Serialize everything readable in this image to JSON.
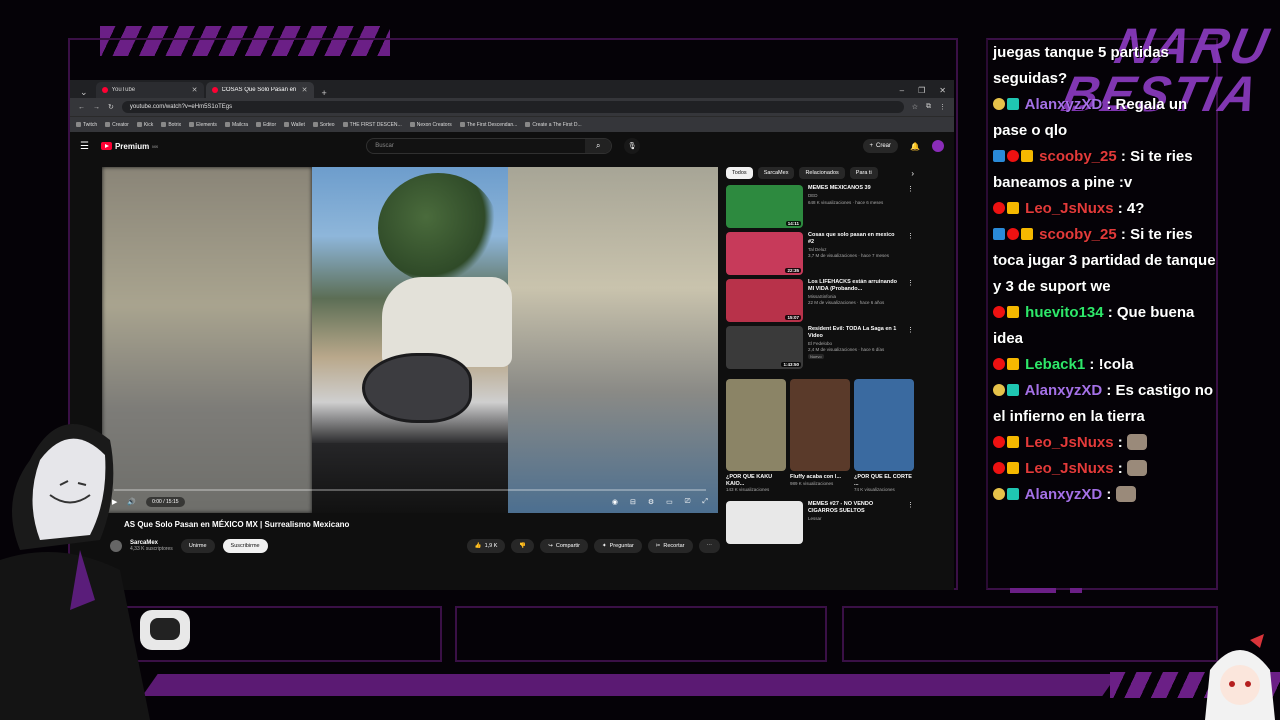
{
  "browser": {
    "tabs": [
      {
        "label": "YouTube"
      },
      {
        "label": "COSAS Que Solo Pasan en MÉX..."
      }
    ],
    "url": "youtube.com/watch?v=eHm5S1oTEgs",
    "bookmarks": [
      "Twitch",
      "Creator",
      "Kick",
      "Botrix",
      "Elements",
      "Mailcra",
      "Editor",
      "Wallet",
      "Sorteo",
      "THE FIRST DESCEN...",
      "Nexon Creators",
      "The First Descendan...",
      "Create a The First D..."
    ]
  },
  "youtube": {
    "logo": "Premium",
    "logo_region": "MX",
    "search_placeholder": "Buscar",
    "create_label": "Crear",
    "player": {
      "time": "0:00 / 15:15"
    },
    "video_title": "AS Que Solo Pasan en MÉXICO MX | Surrealismo Mexicano",
    "channel": {
      "name": "SarcaMex",
      "subs": "4,33 K suscriptores",
      "join_label": "Unirme",
      "subscribe_label": "Suscribirme"
    },
    "actions": {
      "likes": "1,9 K",
      "share": "Compartir",
      "ask": "Preguntar",
      "clip": "Recortar"
    },
    "chips": [
      "Todos",
      "SarcaMex",
      "Relacionados",
      "Para ti"
    ],
    "recommendations": [
      {
        "title": "MEMES MEXICANOS 39",
        "channel": "DED",
        "meta": "648 K visualizaciones · hace 6 meses",
        "duration": "14:11",
        "color": "#2d8a3f"
      },
      {
        "title": "Cosas que solo pasan en mexico #2",
        "channel": "Tal Deluz",
        "meta": "3,7 M de visualizaciones · hace 7 meses",
        "duration": "22:35",
        "color": "#c73a5a"
      },
      {
        "title": "Los LIFEHACKS están arruinando MI VIDA (Probando...",
        "channel": "MissaSinfonia",
        "meta": "22 M de visualizaciones · hace 6 años",
        "duration": "15:07",
        "color": "#b8324a"
      },
      {
        "title": "Resident Evil: TODA La Saga en 1 Video",
        "channel": "El Fedelobo",
        "meta": "2,4 M de visualizaciones · hace 6 días",
        "duration": "1:43:50",
        "badge": "Nuevo",
        "color": "#3a3a3a"
      }
    ],
    "shorts": [
      {
        "title": "¿POR QUE KAKU KAIO...",
        "views": "143 K visualizaciones",
        "color": "#8b8466"
      },
      {
        "title": "Fluffy acaba con l...",
        "views": "989 K visualizaciones",
        "color": "#5a3a2a"
      },
      {
        "title": "¿POR QUE EL CORTE ...",
        "views": "74 K visualizaciones",
        "color": "#3a6aa0"
      }
    ],
    "last_rec": {
      "title": "MEMES #27 - NO VENDO CIGARROS SUELTOS",
      "channel": "Lessar"
    }
  },
  "chat": {
    "messages": [
      {
        "user": "",
        "text": "juegas tanque 5 partidas seguidas?",
        "color": "",
        "badges": []
      },
      {
        "user": "AlanxyzXD",
        "text": "Regala un pase o qlo",
        "color": "purple",
        "badges": [
          "yellow",
          "teal"
        ]
      },
      {
        "user": "scooby_25",
        "text": "Si te ries baneamos a pine :v",
        "color": "red",
        "badges": [
          "blue",
          "red",
          "crown"
        ]
      },
      {
        "user": "Leo_JsNuxs",
        "text": "4?",
        "color": "red",
        "badges": [
          "red",
          "crown"
        ]
      },
      {
        "user": "scooby_25",
        "text": "Si te ries toca jugar 3 partidad de tanque y 3 de suport we",
        "color": "red",
        "badges": [
          "blue",
          "red",
          "crown"
        ]
      },
      {
        "user": "huevito134",
        "text": "Que buena idea",
        "color": "green",
        "badges": [
          "red",
          "crown"
        ]
      },
      {
        "user": "Leback1",
        "text": "!cola",
        "color": "green",
        "badges": [
          "red",
          "crown"
        ]
      },
      {
        "user": "AlanxyzXD",
        "text": "Es castigo no el infierno en la tierra",
        "color": "purple",
        "badges": [
          "yellow",
          "teal"
        ]
      },
      {
        "user": "Leo_JsNuxs",
        "text": "",
        "color": "red",
        "badges": [
          "red",
          "crown"
        ],
        "emote": true
      },
      {
        "user": "Leo_JsNuxs",
        "text": "",
        "color": "red",
        "badges": [
          "red",
          "crown"
        ],
        "emote": true
      },
      {
        "user": "AlanxyzXD",
        "text": "",
        "color": "purple",
        "badges": [
          "yellow",
          "teal"
        ],
        "emote": true
      }
    ]
  },
  "overlay": {
    "brand": "NARU BESTIA",
    "accent": "#6b1f86"
  }
}
